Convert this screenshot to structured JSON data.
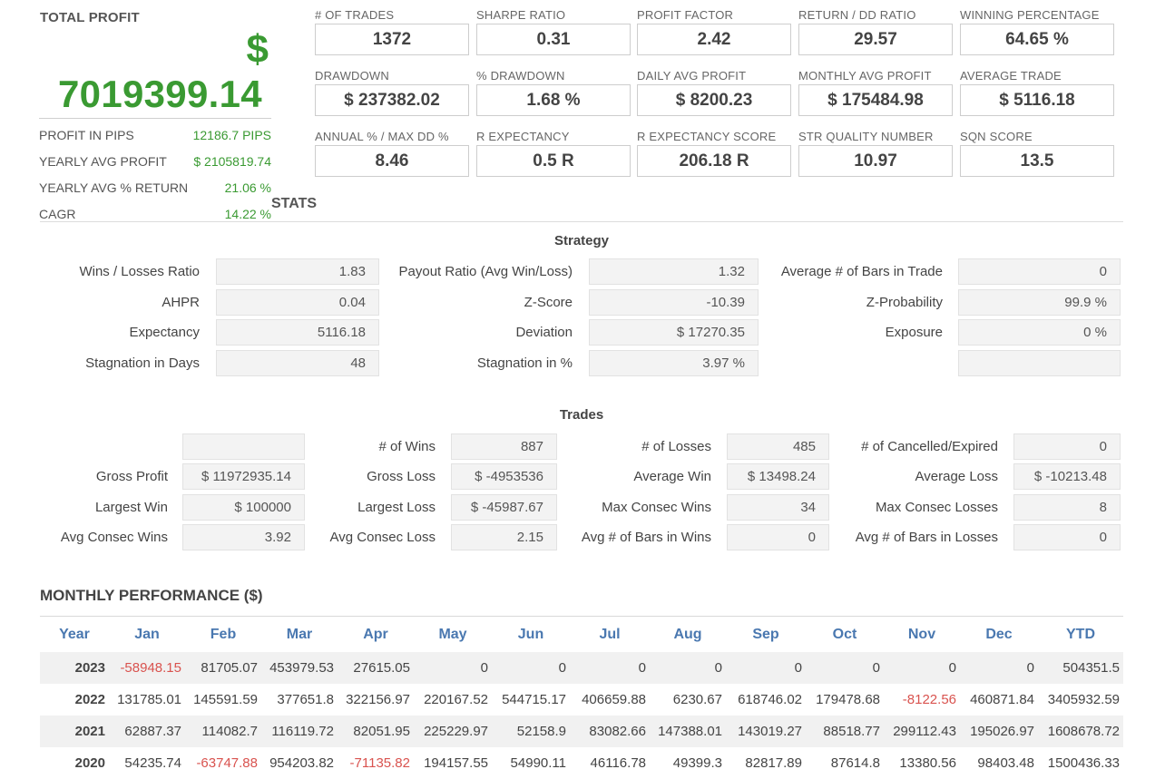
{
  "summary": {
    "total_profit_label": "TOTAL PROFIT",
    "currency": "$",
    "total_profit_value": "7019399.14",
    "rows": [
      {
        "label": "PROFIT IN PIPS",
        "value": "12186.7 PIPS"
      },
      {
        "label": "YEARLY AVG PROFIT",
        "value": "$ 2105819.74"
      },
      {
        "label": "YEARLY AVG % RETURN",
        "value": "21.06 %"
      },
      {
        "label": "CAGR",
        "value": "14.22 %"
      }
    ]
  },
  "stats_title": "STATS",
  "metrics": [
    {
      "label": "# OF TRADES",
      "value": "1372"
    },
    {
      "label": "SHARPE RATIO",
      "value": "0.31"
    },
    {
      "label": "PROFIT FACTOR",
      "value": "2.42"
    },
    {
      "label": "RETURN / DD RATIO",
      "value": "29.57"
    },
    {
      "label": "WINNING PERCENTAGE",
      "value": "64.65 %"
    },
    {
      "label": "DRAWDOWN",
      "value": "$ 237382.02"
    },
    {
      "label": "% DRAWDOWN",
      "value": "1.68 %"
    },
    {
      "label": "DAILY AVG PROFIT",
      "value": "$ 8200.23"
    },
    {
      "label": "MONTHLY AVG PROFIT",
      "value": "$ 175484.98"
    },
    {
      "label": "AVERAGE TRADE",
      "value": "$ 5116.18"
    },
    {
      "label": "ANNUAL % / MAX DD %",
      "value": "8.46"
    },
    {
      "label": "R EXPECTANCY",
      "value": "0.5 R"
    },
    {
      "label": "R EXPECTANCY SCORE",
      "value": "206.18 R"
    },
    {
      "label": "STR QUALITY NUMBER",
      "value": "10.97"
    },
    {
      "label": "SQN SCORE",
      "value": "13.5"
    }
  ],
  "strategy": {
    "title": "Strategy",
    "fields": [
      {
        "label": "Wins / Losses Ratio",
        "value": "1.83"
      },
      {
        "label": "Payout Ratio (Avg Win/Loss)",
        "value": "1.32"
      },
      {
        "label": "Average # of Bars in Trade",
        "value": "0"
      },
      {
        "label": "AHPR",
        "value": "0.04"
      },
      {
        "label": "Z-Score",
        "value": "-10.39"
      },
      {
        "label": "Z-Probability",
        "value": "99.9 %"
      },
      {
        "label": "Expectancy",
        "value": "5116.18"
      },
      {
        "label": "Deviation",
        "value": "$ 17270.35"
      },
      {
        "label": "Exposure",
        "value": "0 %"
      },
      {
        "label": "Stagnation in Days",
        "value": "48"
      },
      {
        "label": "Stagnation in %",
        "value": "3.97 %"
      },
      {
        "label": "",
        "value": ""
      }
    ]
  },
  "trades": {
    "title": "Trades",
    "fields": [
      {
        "label": "",
        "value": ""
      },
      {
        "label": "# of Wins",
        "value": "887"
      },
      {
        "label": "# of Losses",
        "value": "485"
      },
      {
        "label": "# of Cancelled/Expired",
        "value": "0"
      },
      {
        "label": "Gross Profit",
        "value": "$ 11972935.14"
      },
      {
        "label": "Gross Loss",
        "value": "$ -4953536"
      },
      {
        "label": "Average Win",
        "value": "$ 13498.24"
      },
      {
        "label": "Average Loss",
        "value": "$ -10213.48"
      },
      {
        "label": "Largest Win",
        "value": "$ 100000"
      },
      {
        "label": "Largest Loss",
        "value": "$ -45987.67"
      },
      {
        "label": "Max Consec Wins",
        "value": "34"
      },
      {
        "label": "Max Consec Losses",
        "value": "8"
      },
      {
        "label": "Avg Consec Wins",
        "value": "3.92"
      },
      {
        "label": "Avg Consec Loss",
        "value": "2.15"
      },
      {
        "label": "Avg # of Bars in Wins",
        "value": "0"
      },
      {
        "label": "Avg # of Bars in Losses",
        "value": "0"
      }
    ]
  },
  "monthly": {
    "title": "MONTHLY PERFORMANCE ($)",
    "headers": [
      "Year",
      "Jan",
      "Feb",
      "Mar",
      "Apr",
      "May",
      "Jun",
      "Jul",
      "Aug",
      "Sep",
      "Oct",
      "Nov",
      "Dec",
      "YTD"
    ],
    "rows": [
      [
        "2023",
        "-58948.15",
        "81705.07",
        "453979.53",
        "27615.05",
        "0",
        "0",
        "0",
        "0",
        "0",
        "0",
        "0",
        "0",
        "504351.5"
      ],
      [
        "2022",
        "131785.01",
        "145591.59",
        "377651.8",
        "322156.97",
        "220167.52",
        "544715.17",
        "406659.88",
        "6230.67",
        "618746.02",
        "179478.68",
        "-8122.56",
        "460871.84",
        "3405932.59"
      ],
      [
        "2021",
        "62887.37",
        "114082.7",
        "116119.72",
        "82051.95",
        "225229.97",
        "52158.9",
        "83082.66",
        "147388.01",
        "143019.27",
        "88518.77",
        "299112.43",
        "195026.97",
        "1608678.72"
      ],
      [
        "2020",
        "54235.74",
        "-63747.88",
        "954203.82",
        "-71135.82",
        "194157.55",
        "54990.11",
        "46116.78",
        "49399.3",
        "82817.89",
        "87614.8",
        "13380.56",
        "98403.48",
        "1500436.33"
      ]
    ]
  },
  "colors": {
    "positive": "#3a9a32",
    "negative": "#d9534f",
    "header_blue": "#4a78b0"
  }
}
